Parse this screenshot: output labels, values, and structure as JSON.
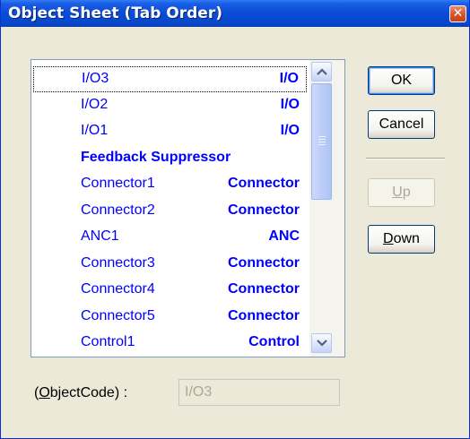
{
  "window": {
    "title": "Object Sheet (Tab Order)",
    "close_glyph": "✕"
  },
  "list": {
    "items": [
      {
        "name": "I/O3",
        "type": "I/O",
        "focused": true
      },
      {
        "name": "I/O2",
        "type": "I/O"
      },
      {
        "name": "I/O1",
        "type": "I/O"
      },
      {
        "name": "",
        "type": "Feedback Suppressor",
        "combined": true
      },
      {
        "name": "Connector1",
        "type": "Connector"
      },
      {
        "name": "Connector2",
        "type": "Connector"
      },
      {
        "name": "ANC1",
        "type": "ANC"
      },
      {
        "name": "Connector3",
        "type": "Connector"
      },
      {
        "name": "Connector4",
        "type": "Connector"
      },
      {
        "name": "Connector5",
        "type": "Connector"
      },
      {
        "name": "Control1",
        "type": "Control"
      }
    ],
    "text_color": "#0000FF"
  },
  "buttons": {
    "ok": "OK",
    "cancel": "Cancel",
    "up_mnemonic": "U",
    "up_rest": "p",
    "down_mnemonic": "D",
    "down_rest": "own"
  },
  "object_code": {
    "label_pre": "(",
    "label_mnemonic": "O",
    "label_rest": "bjectCode) :",
    "value": "I/O3"
  },
  "icons": {
    "close": "close-icon",
    "scroll_up": "chevron-up-icon",
    "scroll_down": "chevron-down-icon"
  }
}
